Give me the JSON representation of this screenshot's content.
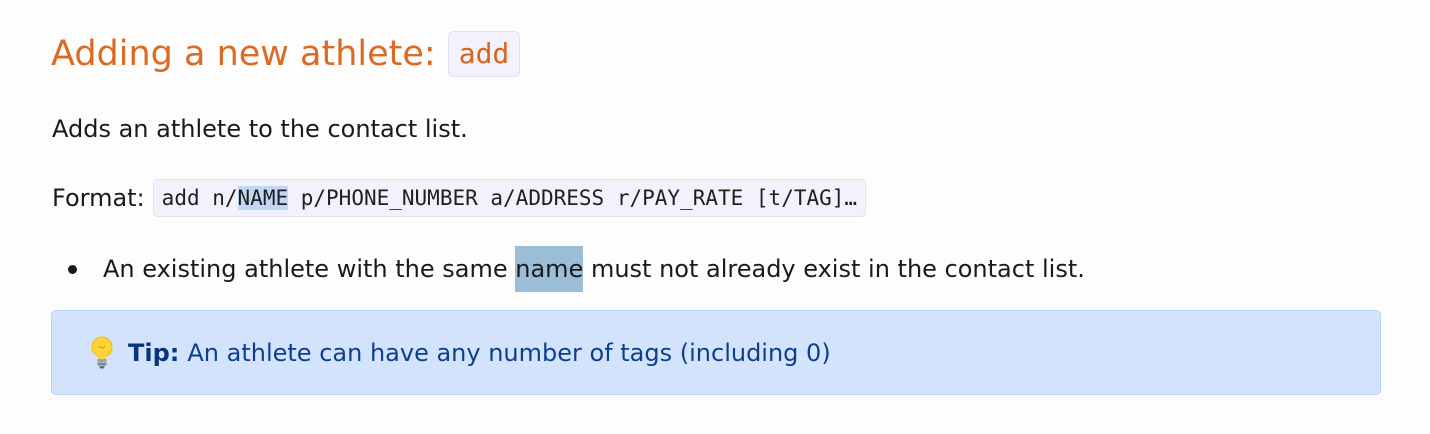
{
  "section": {
    "title": "Adding a new athlete:",
    "command": "add",
    "description": "Adds an athlete to the contact list.",
    "format": {
      "label": "Format:",
      "code_prefix": "add n/",
      "code_highlight": "NAME",
      "code_suffix": " p/PHONE_NUMBER a/ADDRESS r/PAY_RATE [t/TAG]…"
    },
    "bullets": [
      {
        "before": "An existing athlete with the same ",
        "highlight": "name",
        "after": " must not already exist in the contact list."
      }
    ],
    "tip": {
      "icon": "lightbulb-icon",
      "label": "Tip:",
      "text": "An athlete can have any number of tags (including 0)"
    }
  },
  "colors": {
    "heading": "#dd6a22",
    "tip_background": "#d4e3fc",
    "tip_text": "#0d3f8c",
    "search_highlight": "#9bbdd5",
    "selection_highlight": "#c3d6f5"
  }
}
